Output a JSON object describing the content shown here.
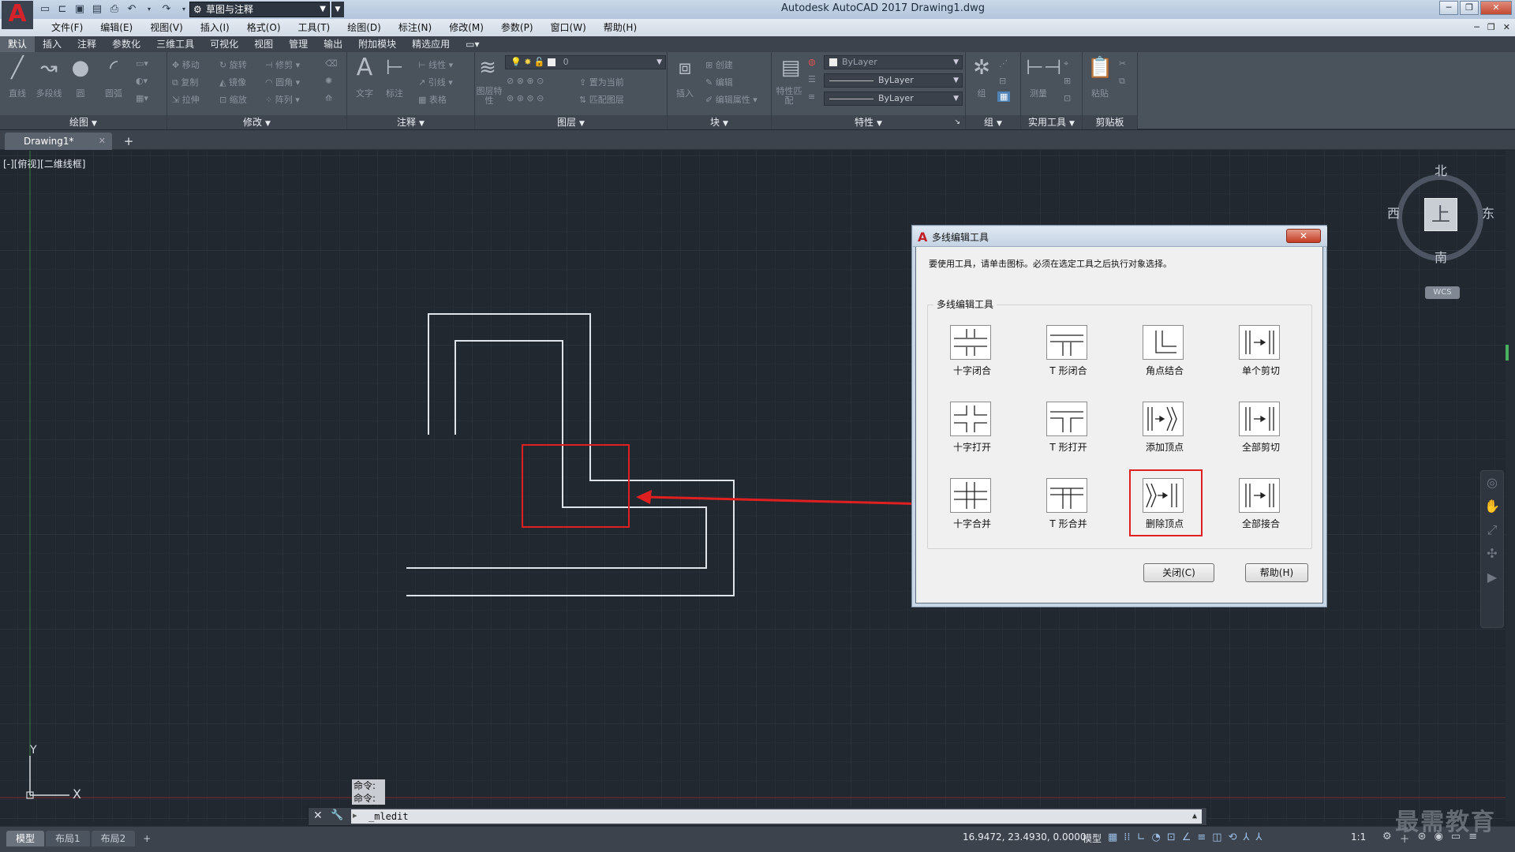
{
  "app": {
    "logo": "A",
    "title": "Autodesk AutoCAD 2017    Drawing1.dwg",
    "workspace": "草图与注释",
    "quick_access": [
      "new-icon",
      "open-icon",
      "save-icon",
      "saveas-icon",
      "print-icon",
      "undo-icon",
      "redo-icon"
    ]
  },
  "menu": [
    "文件(F)",
    "编辑(E)",
    "视图(V)",
    "插入(I)",
    "格式(O)",
    "工具(T)",
    "绘图(D)",
    "标注(N)",
    "修改(M)",
    "参数(P)",
    "窗口(W)",
    "帮助(H)"
  ],
  "ribbon_tabs": [
    "默认",
    "插入",
    "注释",
    "参数化",
    "三维工具",
    "可视化",
    "视图",
    "管理",
    "输出",
    "附加模块",
    "精选应用"
  ],
  "ribbon": {
    "draw": {
      "title": "绘图",
      "items": [
        "直线",
        "多段线",
        "圆",
        "圆弧"
      ]
    },
    "modify": {
      "title": "修改",
      "items": [
        "移动",
        "旋转",
        "修剪",
        "复制",
        "镜像",
        "圆角",
        "拉伸",
        "缩放",
        "阵列"
      ]
    },
    "annotation": {
      "title": "注释",
      "items": [
        "文字",
        "标注",
        "线性",
        "引线",
        "表格"
      ]
    },
    "layers": {
      "title": "图层",
      "items": [
        "图层特性",
        "置为当前",
        "匹配图层"
      ],
      "current_layer": "0"
    },
    "block": {
      "title": "块",
      "items": [
        "插入",
        "创建",
        "编辑",
        "编辑属性"
      ]
    },
    "properties": {
      "title": "特性",
      "items": [
        "特性匹配"
      ],
      "color": "ByLayer",
      "linetype": "ByLayer",
      "lineweight": "ByLayer"
    },
    "groups": {
      "title": "组",
      "items": [
        "组"
      ]
    },
    "utilities": {
      "title": "实用工具",
      "items": [
        "测量"
      ]
    },
    "clipboard": {
      "title": "剪贴板",
      "items": [
        "粘贴"
      ]
    }
  },
  "document_tab": "Drawing1*",
  "viewport_label": "[-][俯视][二维线框]",
  "viewcube": {
    "north": "北",
    "south": "南",
    "east": "东",
    "west": "西",
    "top": "上",
    "wcs": "WCS"
  },
  "ucs": {
    "x": "X",
    "y": "Y"
  },
  "dialog": {
    "title": "多线编辑工具",
    "close_x": "✕",
    "instruction": "要使用工具，请单击图标。必须在选定工具之后执行对象选择。",
    "group_label": "多线编辑工具",
    "tools": [
      {
        "label": "十字闭合"
      },
      {
        "label": "T 形闭合"
      },
      {
        "label": "角点结合"
      },
      {
        "label": "单个剪切"
      },
      {
        "label": "十字打开"
      },
      {
        "label": "T 形打开"
      },
      {
        "label": "添加顶点"
      },
      {
        "label": "全部剪切"
      },
      {
        "label": "十字合并"
      },
      {
        "label": "T 形合并"
      },
      {
        "label": "删除顶点"
      },
      {
        "label": "全部接合"
      }
    ],
    "highlighted_tool": "删除顶点",
    "close_button": "关闭(C)",
    "help_button": "帮助(H)"
  },
  "command": {
    "history": [
      "命令:",
      "命令:"
    ],
    "input": "_mledit"
  },
  "status": {
    "layout_tabs": [
      "模型",
      "布局1",
      "布局2"
    ],
    "coords": "16.9472, 23.4930, 0.0000",
    "mode": "模型",
    "scale": "1:1"
  },
  "watermark": "最需教育",
  "colors": {
    "highlight": "#e02020",
    "canvas": "#212830",
    "ribbon": "#4a525c"
  }
}
